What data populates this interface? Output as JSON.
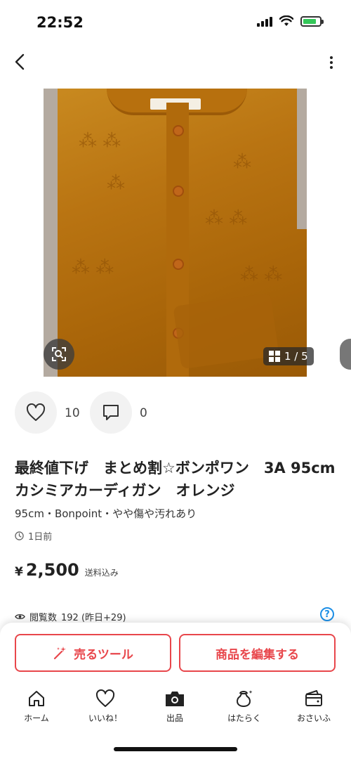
{
  "status_bar": {
    "time": "22:52"
  },
  "gallery": {
    "counter": "1 / 5"
  },
  "actions": {
    "like_count": "10",
    "comment_count": "0"
  },
  "item": {
    "title": "最終値下げ　まとめ割☆ボンポワン　3A 95cm カシミアカーディガン　オレンジ",
    "subtitle": "95cm・Bonpoint・やや傷や汚れあり",
    "posted": "1日前",
    "price_currency": "¥",
    "price": "2,500",
    "shipping": "送料込み"
  },
  "views": {
    "label": "閲覧数",
    "value": "192 (昨日+29)"
  },
  "buttons": {
    "tool": "売るツール",
    "edit": "商品を編集する"
  },
  "tabs": [
    {
      "label": "ホーム",
      "icon": "home-icon"
    },
    {
      "label": "いいね！",
      "icon": "heart-icon"
    },
    {
      "label": "出品",
      "icon": "camera-icon"
    },
    {
      "label": "はたらく",
      "icon": "bag-icon"
    },
    {
      "label": "おさいふ",
      "icon": "wallet-icon"
    }
  ],
  "colors": {
    "accent": "#e8464b",
    "help": "#1d8fe6",
    "battery": "#34c759"
  }
}
